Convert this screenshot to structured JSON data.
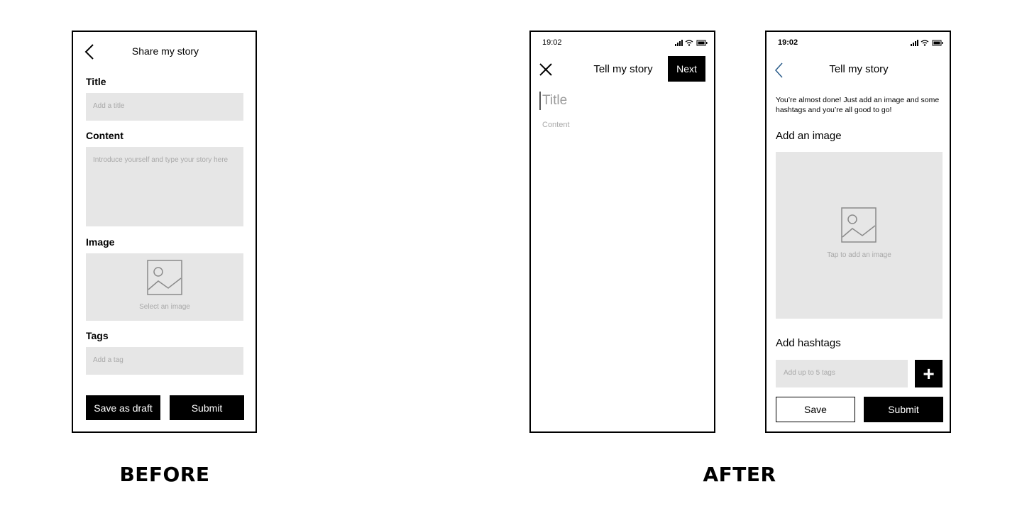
{
  "before": {
    "header_title": "Share my story",
    "title_label": "Title",
    "title_placeholder": "Add a title",
    "content_label": "Content",
    "content_placeholder": "Introduce yourself and type your story here",
    "image_label": "Image",
    "image_placeholder": "Select an image",
    "tags_label": "Tags",
    "tags_placeholder": "Add a tag",
    "draft_button": "Save as draft",
    "submit_button": "Submit",
    "caption": "BEFORE"
  },
  "after_editor": {
    "time": "19:02",
    "header_title": "Tell my story",
    "next_button": "Next",
    "title_placeholder": "Title",
    "content_placeholder": "Content"
  },
  "after_finalize": {
    "time": "19:02",
    "header_title": "Tell my story",
    "intro_text": "You’re almost done! Just add an image and some hashtags and you’re all good to go!",
    "image_heading": "Add an image",
    "image_placeholder": "Tap to add an image",
    "hashtags_heading": "Add hashtags",
    "hashtags_placeholder": "Add up to 5 tags",
    "add_button": "+",
    "save_button": "Save",
    "submit_button": "Submit"
  },
  "after_caption": "AFTER"
}
